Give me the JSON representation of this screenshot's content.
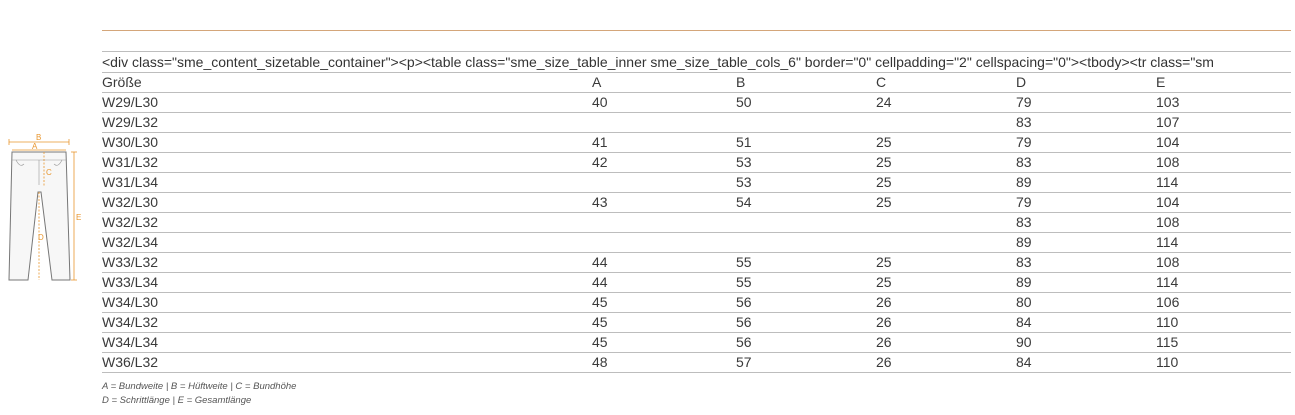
{
  "raw_code_text": "<div class=\"sme_content_sizetable_container\"><p><table class=\"sme_size_table_inner sme_size_table_cols_6\" border=\"0\" cellpadding=\"2\" cellspacing=\"0\"><tbody><tr class=\"sm",
  "illustration": {
    "labels": {
      "a": "A",
      "b": "B",
      "c": "C",
      "d": "D",
      "e": "E"
    },
    "accent_color": "#e8962e"
  },
  "table": {
    "headers": [
      "Größe",
      "A",
      "B",
      "C",
      "D",
      "E"
    ],
    "rows": [
      [
        "W29/L30",
        "40",
        "50",
        "24",
        "79",
        "103"
      ],
      [
        "W29/L32",
        "",
        "",
        "",
        "83",
        "107"
      ],
      [
        "W30/L30",
        "41",
        "51",
        "25",
        "79",
        "104"
      ],
      [
        "W31/L32",
        "42",
        "53",
        "25",
        "83",
        "108"
      ],
      [
        "W31/L34",
        "",
        "53",
        "25",
        "89",
        "114"
      ],
      [
        "W32/L30",
        "43",
        "54",
        "25",
        "79",
        "104"
      ],
      [
        "W32/L32",
        "",
        "",
        "",
        "83",
        "108"
      ],
      [
        "W32/L34",
        "",
        "",
        "",
        "89",
        "114"
      ],
      [
        "W33/L32",
        "44",
        "55",
        "25",
        "83",
        "108"
      ],
      [
        "W33/L34",
        "44",
        "55",
        "25",
        "89",
        "114"
      ],
      [
        "W34/L30",
        "45",
        "56",
        "26",
        "80",
        "106"
      ],
      [
        "W34/L32",
        "45",
        "56",
        "26",
        "84",
        "110"
      ],
      [
        "W34/L34",
        "45",
        "56",
        "26",
        "90",
        "115"
      ],
      [
        "W36/L32",
        "48",
        "57",
        "26",
        "84",
        "110"
      ]
    ]
  },
  "legend": {
    "line1": "A = Bundweite | B = Hüftweite | C = Bundhöhe",
    "line2": "D = Schrittlänge | E = Gesamtlänge"
  }
}
